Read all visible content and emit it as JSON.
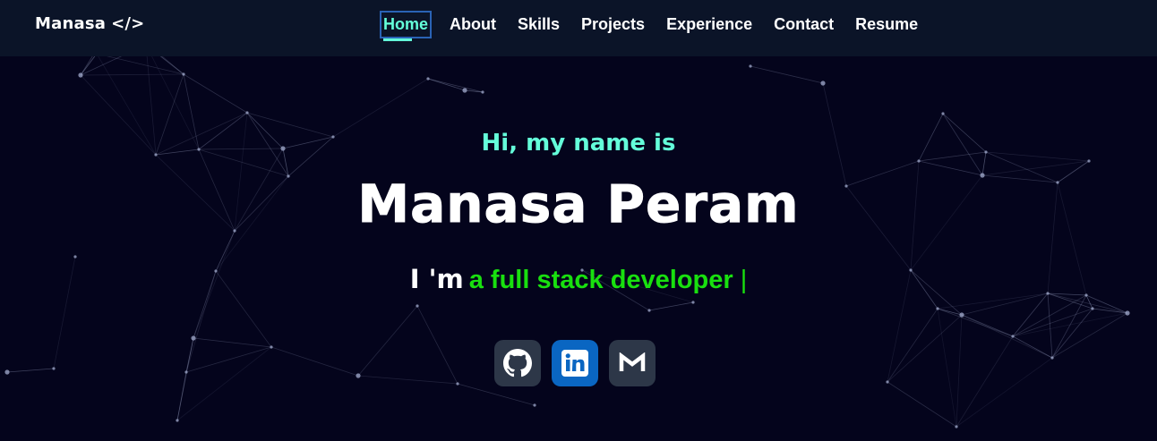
{
  "brand": {
    "name": "Manasa",
    "code_symbol": "</>"
  },
  "nav": {
    "items": [
      {
        "label": "Home",
        "active": true
      },
      {
        "label": "About"
      },
      {
        "label": "Skills"
      },
      {
        "label": "Projects"
      },
      {
        "label": "Experience"
      },
      {
        "label": "Contact"
      },
      {
        "label": "Resume"
      }
    ]
  },
  "hero": {
    "greeting": "Hi, my name is",
    "name": "Manasa Peram",
    "tagline_prefix": "I 'm",
    "tagline_role": "a full stack developer",
    "cursor": "|"
  },
  "socials": [
    {
      "icon": "github-icon",
      "color": "#2d3748"
    },
    {
      "icon": "linkedin-icon",
      "color": "#0a66c2"
    },
    {
      "icon": "gmail-icon",
      "color": "#2d3748"
    }
  ],
  "colors": {
    "background": "#04041c",
    "navbar": "#0b1428",
    "accent": "#64ffda",
    "role_text": "#19e00f",
    "particles": "#9aa3c4"
  }
}
